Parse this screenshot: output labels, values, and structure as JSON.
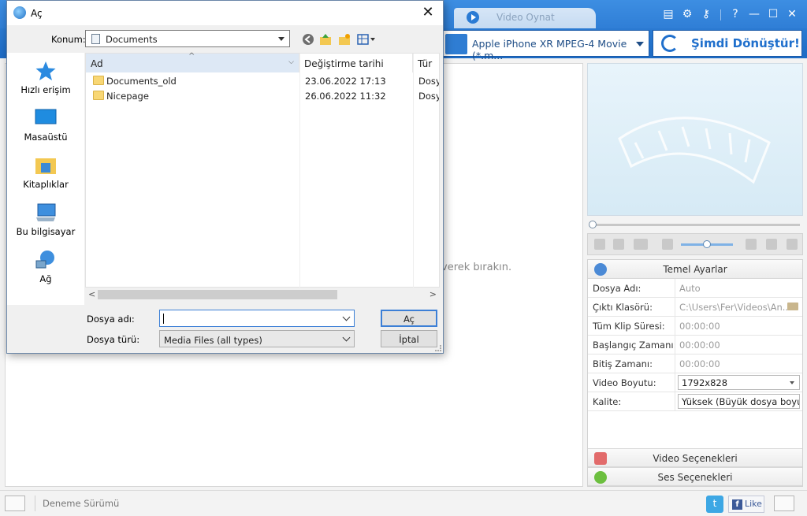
{
  "app": {
    "tab_inactive": "Video Oynat",
    "format_select": "Apple iPhone XR MPEG-4 Movie (*.m...",
    "convert_button": "Şimdi Dönüştür!",
    "drop_text": "verek bırakın.",
    "status_text": "Deneme Sürümü",
    "like_label": "Like",
    "twitter_glyph": "t",
    "facebook_glyph": "f"
  },
  "settings": {
    "header": "Temel Ayarlar",
    "rows": [
      {
        "key": "Dosya Adı:",
        "value": "Auto"
      },
      {
        "key": "Çıktı Klasörü:",
        "value": "C:\\Users\\Fer\\Videos\\An..."
      },
      {
        "key": "Tüm Klip Süresi:",
        "value": "00:00:00"
      },
      {
        "key": "Başlangıç Zamanı:",
        "value": "00:00:00"
      },
      {
        "key": "Bitiş Zamanı:",
        "value": "00:00:00"
      },
      {
        "key": "Video Boyutu:",
        "value": "1792x828"
      },
      {
        "key": "Kalite:",
        "value": "Yüksek (Büyük dosya boyutu)"
      }
    ],
    "video_options": "Video Seçenekleri",
    "audio_options": "Ses Seçenekleri"
  },
  "dialog": {
    "title": "Aç",
    "close_glyph": "✕",
    "location_label": "Konum:",
    "location_value": "Documents",
    "places": [
      "Hızlı erişim",
      "Masaüstü",
      "Kitaplıklar",
      "Bu bilgisayar",
      "Ağ"
    ],
    "columns": {
      "name": "Ad",
      "modified": "Değiştirme tarihi",
      "type": "Tür"
    },
    "files": [
      {
        "name": "Documents_old",
        "modified": "23.06.2022 17:13",
        "type": "Dosya klasörü"
      },
      {
        "name": "Nicepage",
        "modified": "26.06.2022 11:32",
        "type": "Dosya klasörü"
      }
    ],
    "filename_label": "Dosya adı:",
    "filename_value": "",
    "filetype_label": "Dosya türü:",
    "filetype_value": "Media Files (all types)",
    "open_button": "Aç",
    "cancel_button": "İptal"
  },
  "colors": {
    "accent": "#2f7ed6",
    "selection": "#dde8f5"
  }
}
